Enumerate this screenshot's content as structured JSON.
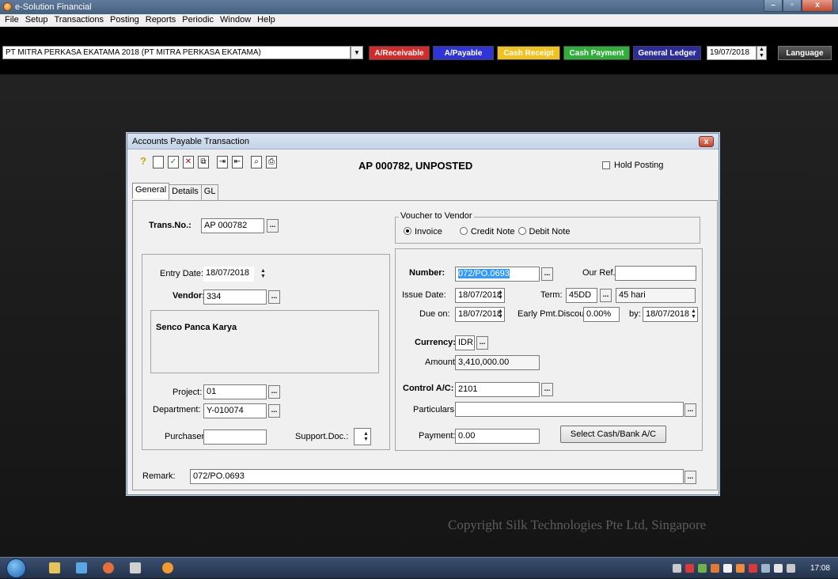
{
  "window": {
    "title": "e-Solution Financial",
    "min": "–",
    "max": "▫",
    "close": "x"
  },
  "menu": [
    "File",
    "Setup",
    "Transactions",
    "Posting",
    "Reports",
    "Periodic",
    "Window",
    "Help"
  ],
  "toolbar": {
    "company": "PT MITRA PERKASA EKATAMA 2018 (PT MITRA PERKASA EKATAMA)",
    "modules": [
      {
        "label": "A/Receivable",
        "color": "#d42a2a"
      },
      {
        "label": "A/Payable",
        "color": "#2e34d8"
      },
      {
        "label": "Cash Receipt",
        "color": "#f1c21e"
      },
      {
        "label": "Cash Payment",
        "color": "#2fae3a"
      },
      {
        "label": "General Ledger",
        "color": "#2c2c9c"
      }
    ],
    "date": "19/07/2018",
    "language": "Language"
  },
  "copyright": "Copyright Silk Technologies Pte Ltd, Singapore",
  "taskbar": {
    "time": "17:08"
  },
  "dialog": {
    "title": "Accounts Payable Transaction",
    "close": "x",
    "heading": "AP 000782, UNPOSTED",
    "hold_posting": "Hold Posting",
    "tabs": [
      "General",
      "Details",
      "GL"
    ],
    "trans_no": {
      "label": "Trans.No.:",
      "value": "AP 000782"
    },
    "voucher": {
      "title": "Voucher to Vendor",
      "options": [
        "Invoice",
        "Credit Note",
        "Debit Note"
      ],
      "selected": "Invoice"
    },
    "left": {
      "entry_date_label": "Entry Date:",
      "entry_date": "18/07/2018",
      "vendor_label": "Vendor:",
      "vendor": "334",
      "vendor_name": "Senco Panca Karya",
      "project_label": "Project:",
      "project": "01",
      "department_label": "Department:",
      "department": "Y-010074",
      "purchaser_label": "Purchaser:",
      "purchaser": "",
      "support_doc_label": "Support.Doc.:",
      "support_doc": ""
    },
    "right": {
      "number_label": "Number:",
      "number": "072/PO.0693",
      "our_ref_label": "Our Ref.:",
      "our_ref": "",
      "issue_date_label": "Issue Date:",
      "issue_date": "18/07/2018",
      "term_label": "Term:",
      "term": "45DD",
      "term_desc": "45 hari",
      "due_on_label": "Due on:",
      "due_on": "18/07/2018",
      "early_discount_label": "Early Pmt.Discount:",
      "early_discount": "0.00%",
      "by_label": "by:",
      "by_date": "18/07/2018",
      "currency_label": "Currency:",
      "currency": "IDR",
      "amount_label": "Amount:",
      "amount": "3,410,000.00",
      "control_ac_label": "Control A/C:",
      "control_ac": "2101",
      "particulars_label": "Particulars:",
      "particulars": "",
      "payment_label": "Payment:",
      "payment": "0.00",
      "select_cash_button": "Select Cash/Bank A/C"
    },
    "remark": {
      "label": "Remark:",
      "value": "072/PO.0693"
    }
  }
}
